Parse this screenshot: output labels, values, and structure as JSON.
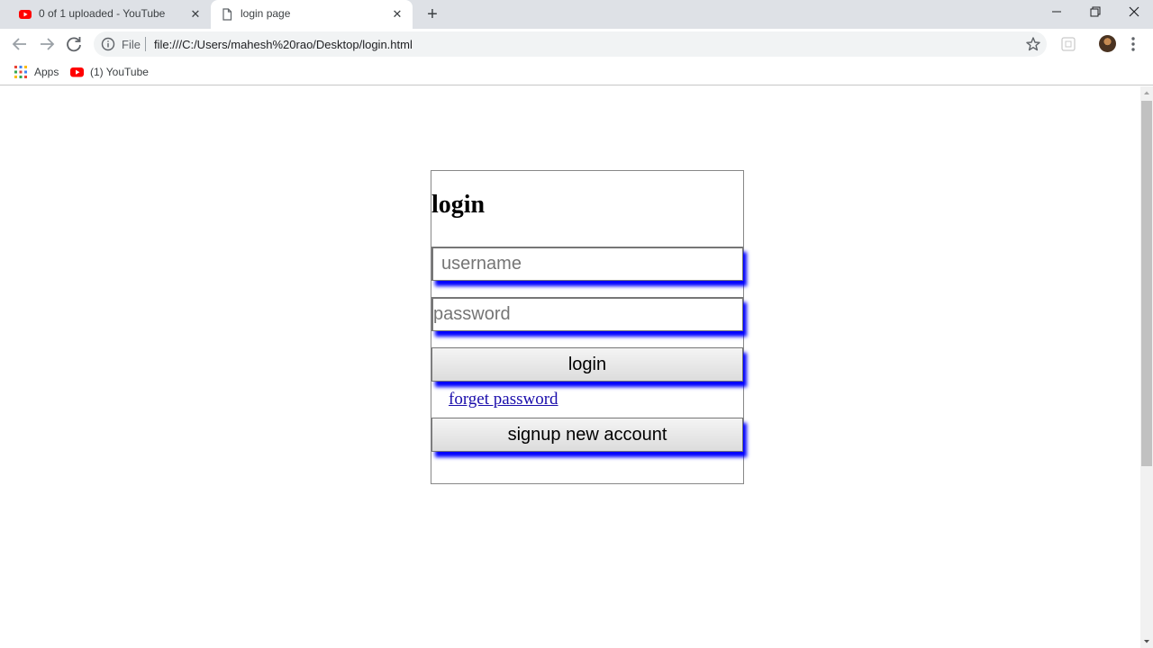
{
  "browser": {
    "tabs": [
      {
        "title": "0 of 1 uploaded - YouTube",
        "icon": "youtube-icon",
        "active": false
      },
      {
        "title": "login page",
        "icon": "page-icon",
        "active": true
      }
    ],
    "new_tab": "+",
    "close_glyph": "✕",
    "address": {
      "scheme_label": "File",
      "url": "file:///C:/Users/mahesh%20rao/Desktop/login.html"
    },
    "bookmarks": [
      {
        "label": "Apps",
        "icon": "apps-grid-icon"
      },
      {
        "label": "(1) YouTube",
        "icon": "youtube-icon"
      }
    ]
  },
  "page": {
    "title": "login",
    "username_placeholder": "username",
    "password_placeholder": "password",
    "login_button": "login",
    "forget_link": "forget password",
    "signup_button": "signup new account"
  },
  "colors": {
    "tabstrip": "#dee1e6",
    "omnibox": "#f1f3f4",
    "shadow": "#0000ff",
    "link": "#1a0dab",
    "youtube": "#ff0000"
  }
}
